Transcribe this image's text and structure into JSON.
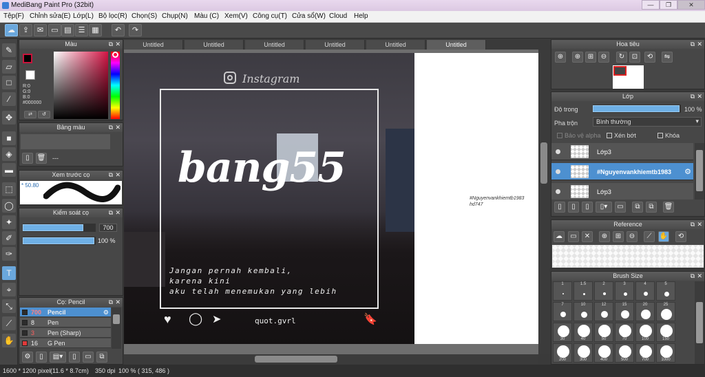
{
  "window": {
    "title": "MediBang Paint Pro (32bit)",
    "min": "—",
    "max": "❐",
    "close": "✕"
  },
  "menu": [
    "Tệp(F)",
    "Chỉnh sửa(E)",
    "Lớp(L)",
    "Bộ lọc(R)",
    "Chọn(S)",
    "Chụp(N)",
    "Màu (C)",
    "Xem(V)",
    "Công cụ(T)",
    "Cửa sổ(W)",
    "Cloud",
    "Help"
  ],
  "tabs": [
    "Untitled",
    "Untitled",
    "Untitled",
    "Untitled",
    "Untitled",
    "Untitled"
  ],
  "color_panel": {
    "title": "Màu",
    "r": "R:0",
    "g": "G:0",
    "b": "B:0",
    "hex": "#000000",
    "fg_color": "#000000",
    "bg_color": "#ffffff",
    "accent": "#c8143c"
  },
  "palette_panel": {
    "title": "Bảng màu",
    "value": "---"
  },
  "preview_panel": {
    "title": "Xem trước cọ",
    "size": "50.80"
  },
  "brush_control": {
    "title": "Kiểm soát cọ",
    "size": "700",
    "opacity": "100 %",
    "size_level": 0.85,
    "opacity_level": 1.0
  },
  "brush_list": {
    "title": "Cọ: Pencil",
    "items": [
      {
        "size": "700",
        "name": "Pencil",
        "color": "#2c2c2c",
        "selected": true
      },
      {
        "size": "8",
        "name": "Pen",
        "color": "#2c2c2c",
        "selected": false
      },
      {
        "size": "3",
        "name": "Pen (Sharp)",
        "color": "#2c2c2c",
        "selected": false
      },
      {
        "size": "16",
        "name": "G Pen",
        "color": "#e03a3a",
        "selected": false
      }
    ]
  },
  "canvas": {
    "instagram_label": "Instagram",
    "headline": "bang55",
    "caption_lines": [
      "Jangan pernah kembali,",
      "karena kini",
      "aku telah menemukan yang lebih"
    ],
    "handle": "quot.gvrl",
    "side_note_1": "#Nguyenvankhiemtb1983",
    "side_note_2": "hd747"
  },
  "navigator": {
    "title": "Hoa tiêu"
  },
  "layer_panel": {
    "title": "Lớp",
    "opacity_label": "Độ trong",
    "opacity_value": "100 %",
    "blend_label": "Pha trộn",
    "blend_value": "Bình thường",
    "protect_alpha": "Bảo vệ alpha",
    "clip": "Xén bớt",
    "lock": "Khóa",
    "opacity_level": 1.0,
    "layers": [
      {
        "name": "Lớp3",
        "selected": false
      },
      {
        "name": "#Nguyenvankhiemtb1983",
        "selected": true
      },
      {
        "name": "Lớp3",
        "selected": false
      }
    ]
  },
  "reference_panel": {
    "title": "Reference"
  },
  "brush_size_panel": {
    "title": "Brush Size",
    "row1": [
      "1",
      "1.5",
      "2",
      "3",
      "4",
      "5"
    ],
    "row2": [
      "7",
      "10",
      "12",
      "15",
      "20",
      "25"
    ],
    "row3": [
      "30",
      "40",
      "50",
      "70",
      "100",
      "150"
    ],
    "row4": [
      "200",
      "300",
      "400",
      "500",
      "700",
      "1000"
    ]
  },
  "status": {
    "size": "1600 * 1200 pixel",
    "cm": "(11.6 * 8.7cm)",
    "dpi": "350 dpi",
    "zoom": "100 %",
    "coords": "( 315, 486 )"
  }
}
